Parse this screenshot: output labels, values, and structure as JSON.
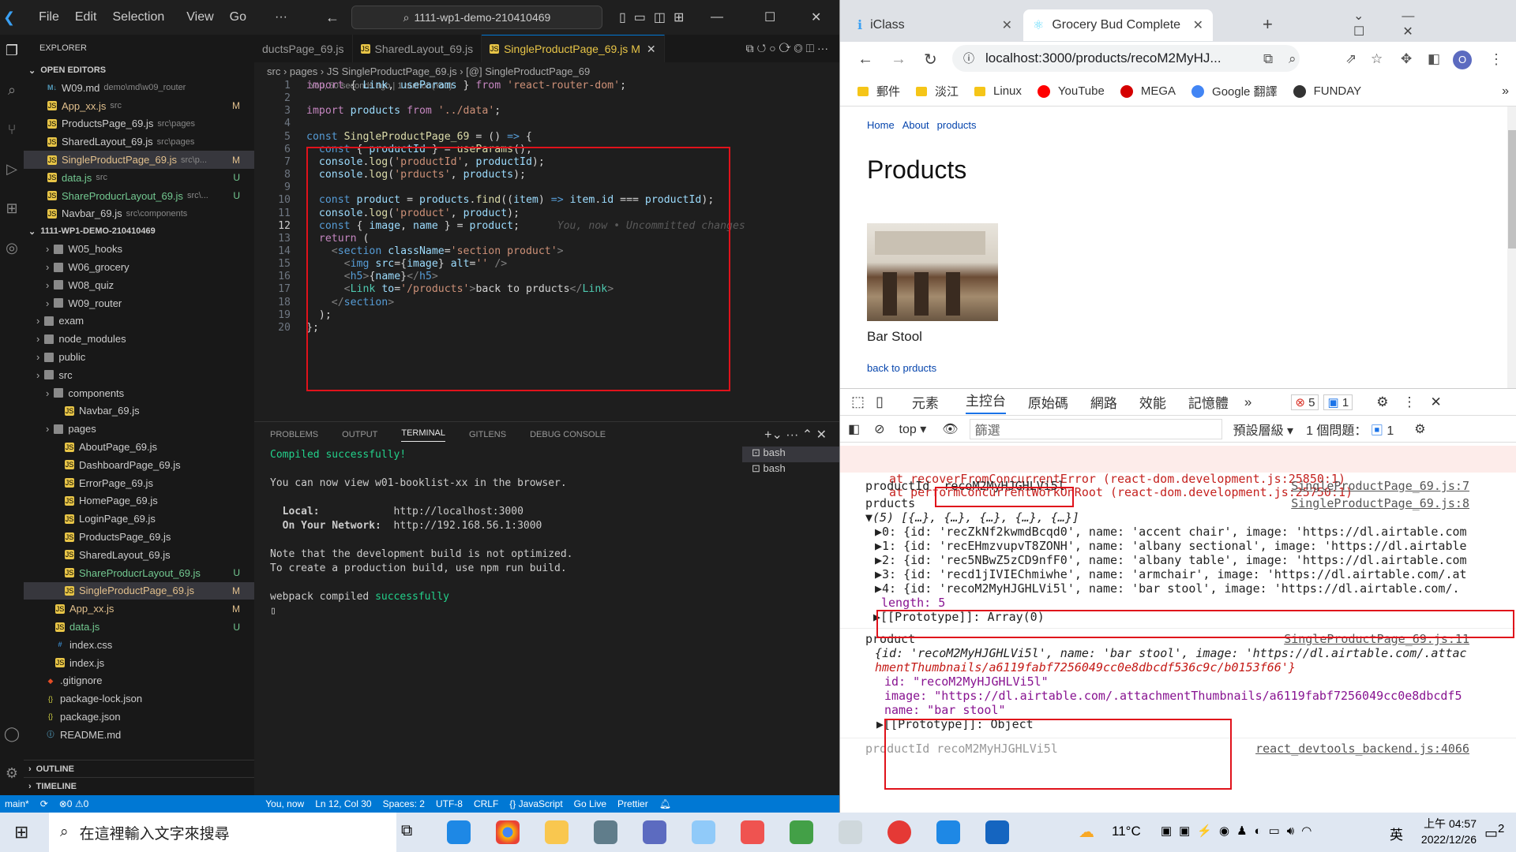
{
  "vscode": {
    "menu": [
      "File",
      "Edit",
      "Selection",
      "View",
      "Go",
      "···"
    ],
    "search": "1111-wp1-demo-210410469",
    "explorer": {
      "title": "EXPLORER",
      "open_editors_title": "OPEN EDITORS",
      "open_editors": [
        {
          "name": "W09.md",
          "sub": "demo\\md\\w09_router",
          "st": "",
          "icon": "md"
        },
        {
          "name": "App_xx.js",
          "sub": "src",
          "st": "M",
          "icon": "js"
        },
        {
          "name": "ProductsPage_69.js",
          "sub": "src\\pages",
          "st": "",
          "icon": "js"
        },
        {
          "name": "SharedLayout_69.js",
          "sub": "src\\pages",
          "st": "",
          "icon": "js"
        },
        {
          "name": "SingleProductPage_69.js",
          "sub": "src\\p...",
          "st": "M",
          "icon": "js"
        },
        {
          "name": "data.js",
          "sub": "src",
          "st": "U",
          "icon": "js"
        },
        {
          "name": "ShareProducrLayout_69.js",
          "sub": "src\\...",
          "st": "U",
          "icon": "js"
        },
        {
          "name": "Navbar_69.js",
          "sub": "src\\components",
          "st": "",
          "icon": "js"
        }
      ],
      "project_title": "1111-WP1-DEMO-210410469",
      "tree": [
        {
          "name": "W05_hooks",
          "icon": "fold",
          "d": 2
        },
        {
          "name": "W06_grocery",
          "icon": "fold",
          "d": 2
        },
        {
          "name": "W08_quiz",
          "icon": "fold",
          "d": 2
        },
        {
          "name": "W09_router",
          "icon": "fold",
          "d": 2
        },
        {
          "name": "exam",
          "icon": "fold",
          "d": 1
        },
        {
          "name": "node_modules",
          "icon": "fold",
          "d": 1
        },
        {
          "name": "public",
          "icon": "fold",
          "d": 1
        },
        {
          "name": "src",
          "icon": "fold",
          "d": 1
        },
        {
          "name": "components",
          "icon": "fold",
          "d": 2
        },
        {
          "name": "Navbar_69.js",
          "icon": "js",
          "d": 3
        },
        {
          "name": "pages",
          "icon": "fold",
          "d": 2
        },
        {
          "name": "AboutPage_69.js",
          "icon": "js",
          "d": 3
        },
        {
          "name": "DashboardPage_69.js",
          "icon": "js",
          "d": 3
        },
        {
          "name": "ErrorPage_69.js",
          "icon": "js",
          "d": 3
        },
        {
          "name": "HomePage_69.js",
          "icon": "js",
          "d": 3
        },
        {
          "name": "LoginPage_69.js",
          "icon": "js",
          "d": 3
        },
        {
          "name": "ProductsPage_69.js",
          "icon": "js",
          "d": 3
        },
        {
          "name": "SharedLayout_69.js",
          "icon": "js",
          "d": 3
        },
        {
          "name": "ShareProducrLayout_69.js",
          "icon": "js",
          "d": 3,
          "st": "U"
        },
        {
          "name": "SingleProductPage_69.js",
          "icon": "js",
          "d": 3,
          "st": "M"
        },
        {
          "name": "App_xx.js",
          "icon": "js",
          "d": 2,
          "st": "M"
        },
        {
          "name": "data.js",
          "icon": "js",
          "d": 2,
          "st": "U"
        },
        {
          "name": "index.css",
          "icon": "css",
          "d": 2
        },
        {
          "name": "index.js",
          "icon": "js",
          "d": 2
        },
        {
          "name": ".gitignore",
          "icon": "git",
          "d": 1
        },
        {
          "name": "package-lock.json",
          "icon": "json",
          "d": 1
        },
        {
          "name": "package.json",
          "icon": "json",
          "d": 1
        },
        {
          "name": "README.md",
          "icon": "md",
          "d": 1
        }
      ],
      "outline": "OUTLINE",
      "timeline": "TIMELINE"
    },
    "tabs": [
      "ductsPage_69.js",
      "SharedLayout_69.js",
      "SingleProductPage_69.js M"
    ],
    "breadcrumb": "src › pages › JS SingleProductPage_69.js › [@] SingleProductPage_69",
    "blame": "You, 50 seconds ago | 1 author (You)",
    "inline_blame": "You, now • Uncommitted changes",
    "panel_tabs": [
      "PROBLEMS",
      "OUTPUT",
      "TERMINAL",
      "GITLENS",
      "DEBUG CONSOLE"
    ],
    "terminal": {
      "compiled": "Compiled successfully!",
      "view": "You can now view w01-booklist-xx in the browser.",
      "local_label": "  Local:",
      "local_url": "http://localhost:3000",
      "net_label": "  On Your Network:",
      "net_url": "http://192.168.56.1:3000",
      "note1": "Note that the development build is not optimized.",
      "note2": "To create a production build, use npm run build.",
      "webpack": "webpack compiled ",
      "webpack2": "successfully"
    },
    "bash": [
      "bash",
      "bash"
    ],
    "status": [
      "main*",
      "⟳",
      "⊗0 ⚠0",
      "You, now",
      "Ln 12, Col 30",
      "Spaces: 2",
      "UTF-8",
      "CRLF",
      "{} JavaScript",
      "Go Live",
      "Prettier"
    ]
  },
  "chrome": {
    "tabs": [
      "iClass",
      "Grocery Bud Complete"
    ],
    "url": "localhost:3000/products/recoM2MyHJ...",
    "bookmarks": [
      "郵件",
      "淡江",
      "Linux",
      "YouTube",
      "MEGA",
      "Google 翻譯",
      "FUNDAY"
    ],
    "page": {
      "nav": [
        "Home",
        "About",
        "products"
      ],
      "title": "Products",
      "product_name": "Bar Stool",
      "back": "back to prducts"
    },
    "devtools": {
      "tabs": [
        "元素",
        "主控台",
        "原始碼",
        "網路",
        "效能",
        "記憶體",
        "»"
      ],
      "errors": "5",
      "infos": "1",
      "top": "top",
      "filter": "篩選",
      "level": "預設層級",
      "issues": "1 個問題：",
      "issues_n": "1"
    },
    "console": {
      "err1": "at recoverFromConcurrentError (react-dom.development.js:25850:1)",
      "err2": "at performConcurrentWorkOnRoot (react-dom.development.js:25750:1)",
      "productId_label": "productId",
      "productId_val": "recoM2MyHJGHLVi5l",
      "ref7": "SingleProductPage_69.js:7",
      "prducts": "prducts",
      "ref8": "SingleProductPage_69.js:8",
      "arr": "▼(5) [{…}, {…}, {…}, {…}, {…}]",
      "items": [
        "▶0: {id: 'recZkNf2kwmdBcqd0', name: 'accent chair', image: 'https://dl.airtable.com",
        "▶1: {id: 'recEHmzvupvT8ZONH', name: 'albany sectional', image: 'https://dl.airtable",
        "▶2: {id: 'rec5NBwZ5zCD9nfF0', name: 'albany table', image: 'https://dl.airtable.com",
        "▶3: {id: 'recd1jIVIEChmiwhe', name: 'armchair', image: 'https://dl.airtable.com/.at",
        "▶4: {id: 'recoM2MyHJGHLVi5l', name: 'bar stool', image: 'https://dl.airtable.com/."
      ],
      "length": "length: 5",
      "proto_arr": "▶[[Prototype]]: Array(0)",
      "product": "product",
      "ref11": "SingleProductPage_69.js:11",
      "obj1": "{id: 'recoM2MyHJGHLVi5l', name: 'bar stool', image: 'https://dl.airtable.com/.attac",
      "obj2": "hmentThumbnails/a6119fabf7256049cc0e8dbcdf536c9c/b0153f66'}",
      "id_line": "id: \"recoM2MyHJGHLVi5l\"",
      "image_line": "image: \"https://dl.airtable.com/.attachmentThumbnails/a6119fabf7256049cc0e8dbcdf5",
      "name_line": "name: \"bar stool\"",
      "proto_obj": "▶[[Prototype]]: Object",
      "last": "productId recoM2MyHJGHLVi5l",
      "ref_last": "react_devtools_backend.js:4066"
    }
  },
  "taskbar": {
    "search": "在這裡輸入文字來搜尋",
    "temp": "11°C",
    "ime": "英",
    "time": "上午 04:57",
    "date": "2022/12/26",
    "notif": "2"
  }
}
